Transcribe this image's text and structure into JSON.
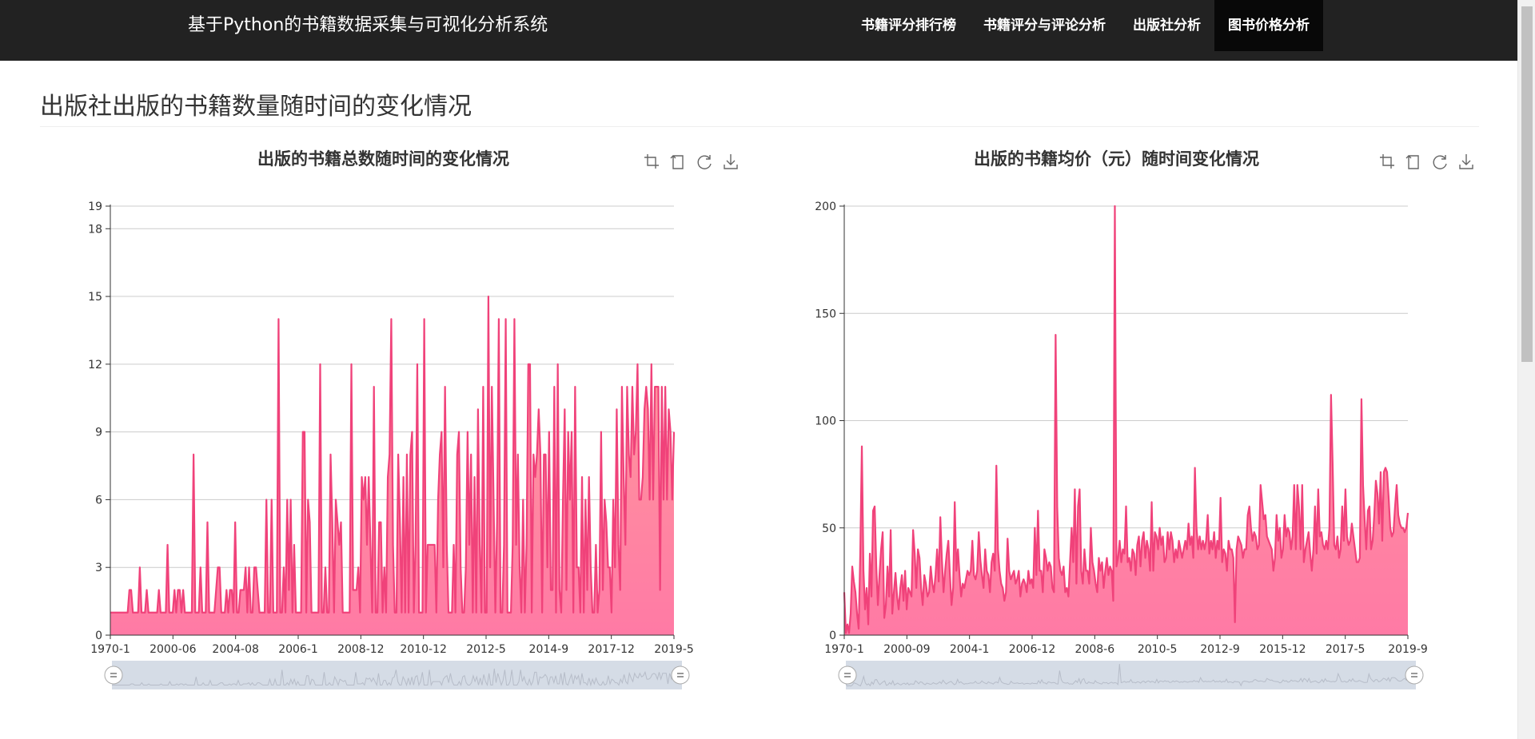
{
  "app": {
    "title": "基于Python的书籍数据采集与可视化分析系统",
    "nav": [
      {
        "label": "书籍评分排行榜",
        "active": false
      },
      {
        "label": "书籍评分与评论分析",
        "active": false
      },
      {
        "label": "出版社分析",
        "active": false
      },
      {
        "label": "图书价格分析",
        "active": true
      }
    ]
  },
  "page": {
    "title": "出版社出版的书籍数量随时间的变化情况"
  },
  "toolbox_icons": [
    "zoom-icon",
    "zoom-reset-icon",
    "restore-icon",
    "download-icon"
  ],
  "colors": {
    "line": "#f0427a",
    "area_top": "#ff9d9b",
    "area_bottom": "#ff7aa5",
    "grid": "#cccccc",
    "slider": "#d5dce6",
    "nav_bg": "#222222"
  },
  "chart_data": [
    {
      "type": "area",
      "title": "出版的书籍总数随时间的变化情况",
      "xlabel": "",
      "ylabel": "",
      "x_tick_labels": [
        "1970-1",
        "2000-06",
        "2004-08",
        "2006-1",
        "2008-12",
        "2010-12",
        "2012-5",
        "2014-9",
        "2017-12",
        "2019-5"
      ],
      "y_ticks": [
        0,
        3,
        6,
        9,
        12,
        15,
        18,
        19
      ],
      "ylim": [
        0,
        19
      ],
      "grid": true,
      "data_zoom_slider": true,
      "series": [
        {
          "values": [
            1,
            1,
            1,
            1,
            1,
            1,
            1,
            1,
            1,
            1,
            1,
            2,
            2,
            1,
            1,
            1,
            1,
            3,
            1,
            1,
            1,
            2,
            1,
            1,
            1,
            1,
            1,
            1,
            2,
            1,
            1,
            1,
            1,
            4,
            1,
            1,
            1,
            2,
            1,
            2,
            2,
            1,
            2,
            1,
            1,
            1,
            1,
            1,
            8,
            1,
            1,
            1,
            3,
            1,
            1,
            1,
            5,
            1,
            1,
            1,
            1,
            2,
            3,
            3,
            1,
            1,
            1,
            2,
            1,
            2,
            2,
            1,
            5,
            1,
            1,
            2,
            2,
            2,
            3,
            1,
            3,
            1,
            1,
            3,
            3,
            2,
            1,
            1,
            1,
            1,
            6,
            1,
            1,
            6,
            1,
            1,
            1,
            14,
            1,
            1,
            3,
            1,
            6,
            2,
            6,
            1,
            4,
            1,
            1,
            1,
            1,
            9,
            9,
            1,
            6,
            5,
            1,
            1,
            1,
            1,
            1,
            12,
            1,
            1,
            3,
            1,
            1,
            8,
            5,
            1,
            6,
            5,
            4,
            5,
            1,
            1,
            1,
            1,
            1,
            12,
            2,
            2,
            2,
            3,
            1,
            7,
            6,
            7,
            4,
            7,
            4,
            1,
            11,
            1,
            1,
            5,
            5,
            1,
            3,
            1,
            7,
            8,
            14,
            4,
            1,
            1,
            8,
            5,
            1,
            7,
            1,
            8,
            1,
            8,
            9,
            1,
            4,
            12,
            1,
            1,
            1,
            14,
            1,
            4,
            4,
            4,
            4,
            4,
            1,
            6,
            8,
            9,
            3,
            11,
            4,
            1,
            1,
            1,
            4,
            1,
            8,
            9,
            3,
            1,
            1,
            3,
            9,
            4,
            8,
            1,
            7,
            1,
            10,
            4,
            1,
            11,
            1,
            1,
            15,
            3,
            11,
            6,
            1,
            5,
            14,
            1,
            1,
            4,
            14,
            1,
            1,
            1,
            4,
            14,
            4,
            8,
            3,
            1,
            6,
            1,
            4,
            12,
            12,
            1,
            8,
            7,
            8,
            10,
            8,
            1,
            8,
            8,
            3,
            9,
            2,
            2,
            11,
            1,
            12,
            2,
            1,
            6,
            10,
            2,
            9,
            6,
            9,
            1,
            11,
            3,
            3,
            1,
            7,
            1,
            6,
            2,
            7,
            3,
            1,
            1,
            4,
            1,
            2,
            9,
            2,
            6,
            5,
            3,
            3,
            1,
            6,
            3,
            10,
            4,
            2,
            11,
            7,
            4,
            11,
            8,
            7,
            11,
            8,
            9,
            12,
            6,
            6,
            7,
            10,
            11,
            10,
            6,
            12,
            6,
            11,
            11,
            11,
            2,
            11,
            6,
            11,
            6,
            10,
            9,
            6,
            9
          ]
        }
      ]
    },
    {
      "type": "area",
      "title": "出版的书籍均价（元）随时间变化情况",
      "xlabel": "",
      "ylabel": "",
      "x_tick_labels": [
        "1970-1",
        "2000-09",
        "2004-1",
        "2006-12",
        "2008-6",
        "2010-5",
        "2012-9",
        "2015-12",
        "2017-5",
        "2019-9"
      ],
      "y_ticks": [
        0,
        50,
        100,
        150,
        200
      ],
      "ylim": [
        0,
        200
      ],
      "grid": true,
      "data_zoom_slider": true,
      "series": [
        {
          "values": [
            20,
            1,
            5,
            1,
            10,
            32,
            25,
            20,
            10,
            3,
            38,
            88,
            30,
            12,
            22,
            5,
            38,
            18,
            58,
            60,
            32,
            14,
            28,
            40,
            48,
            8,
            14,
            32,
            18,
            49,
            10,
            20,
            29,
            18,
            12,
            22,
            28,
            16,
            30,
            12,
            22,
            20,
            18,
            49,
            38,
            22,
            40,
            36,
            22,
            14,
            28,
            24,
            18,
            20,
            32,
            24,
            20,
            28,
            40,
            25,
            55,
            35,
            20,
            30,
            38,
            44,
            28,
            14,
            22,
            62,
            30,
            40,
            28,
            18,
            24,
            22,
            26,
            30,
            28,
            30,
            44,
            28,
            26,
            30,
            48,
            35,
            28,
            22,
            40,
            30,
            28,
            20,
            34,
            38,
            30,
            79,
            40,
            30,
            24,
            22,
            16,
            20,
            45,
            30,
            26,
            28,
            30,
            24,
            26,
            30,
            18,
            24,
            26,
            24,
            20,
            30,
            24,
            26,
            22,
            50,
            28,
            58,
            30,
            30,
            20,
            40,
            36,
            30,
            34,
            32,
            22,
            20,
            140,
            60,
            36,
            30,
            28,
            32,
            20,
            22,
            18,
            34,
            50,
            34,
            68,
            24,
            60,
            68,
            30,
            24,
            40,
            30,
            30,
            24,
            50,
            34,
            30,
            24,
            20,
            36,
            30,
            34,
            22,
            30,
            36,
            28,
            32,
            30,
            16,
            200,
            32,
            36,
            44,
            34,
            40,
            38,
            60,
            34,
            36,
            30,
            40,
            38,
            28,
            42,
            46,
            32,
            44,
            48,
            36,
            44,
            40,
            30,
            62,
            30,
            48,
            46,
            40,
            50,
            42,
            46,
            34,
            36,
            48,
            40,
            48,
            44,
            34,
            40,
            36,
            44,
            40,
            36,
            40,
            44,
            40,
            52,
            42,
            46,
            36,
            78,
            50,
            40,
            46,
            40,
            44,
            40,
            44,
            56,
            38,
            44,
            40,
            48,
            36,
            44,
            40,
            64,
            34,
            40,
            38,
            30,
            44,
            40,
            40,
            36,
            6,
            40,
            46,
            44,
            42,
            36,
            40,
            40,
            56,
            60,
            50,
            44,
            48,
            46,
            40,
            42,
            70,
            62,
            54,
            56,
            46,
            44,
            42,
            40,
            30,
            36,
            56,
            44,
            50,
            36,
            40,
            56,
            46,
            50,
            48,
            40,
            46,
            70,
            40,
            70,
            60,
            40,
            70,
            34,
            40,
            44,
            48,
            38,
            30,
            40,
            60,
            38,
            68,
            46,
            48,
            42,
            40,
            44,
            40,
            50,
            112,
            80,
            42,
            40,
            46,
            36,
            40,
            60,
            44,
            68,
            46,
            42,
            44,
            52,
            46,
            40,
            34,
            34,
            36,
            110,
            70,
            54,
            40,
            58,
            60,
            40,
            44,
            56,
            72,
            66,
            52,
            76,
            44,
            76,
            78,
            76,
            64,
            50,
            46,
            48,
            60,
            70,
            56,
            52,
            50,
            50,
            48,
            50,
            57
          ]
        }
      ]
    }
  ]
}
